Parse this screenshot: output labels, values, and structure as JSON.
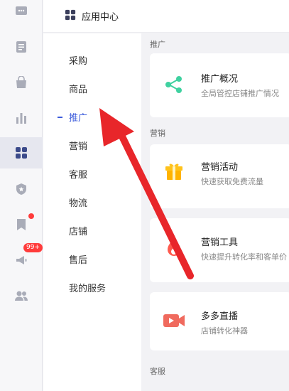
{
  "header": {
    "title": "应用中心",
    "icon": "apps-grid-icon"
  },
  "rail": {
    "icons": [
      "chat-icon",
      "document-icon",
      "shopping-bag-icon",
      "bar-chart-icon",
      "apps-grid-icon",
      "shield-star-icon",
      "bookmark-icon",
      "megaphone-icon",
      "users-icon"
    ],
    "badge_count": "99+"
  },
  "sub_nav": {
    "items": [
      "采购",
      "商品",
      "推广",
      "营销",
      "客服",
      "物流",
      "店铺",
      "售后",
      "我的服务"
    ],
    "active": "推广"
  },
  "sections": {
    "promotion": {
      "label": "推广",
      "cards": [
        {
          "title": "推广概况",
          "desc": "全局管控店铺推广情况",
          "icon": "share-nodes-icon"
        }
      ]
    },
    "marketing": {
      "label": "营销",
      "cards": [
        {
          "title": "营销活动",
          "desc": "快速获取免费流量",
          "icon": "gift-box-icon"
        },
        {
          "title": "营销工具",
          "desc": "快速提升转化率和客单价",
          "icon": "flame-icon"
        },
        {
          "title": "多多直播",
          "desc": "店铺转化神器",
          "icon": "video-camera-icon"
        }
      ]
    },
    "service": {
      "label": "客服"
    }
  },
  "colors": {
    "accent": "#3b5bdb",
    "arrow": "#e8262a",
    "badge": "#ff3b3b"
  }
}
